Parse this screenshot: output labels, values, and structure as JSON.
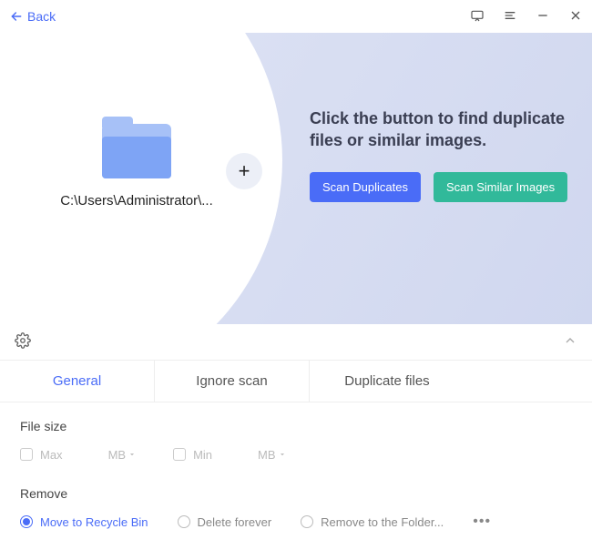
{
  "titlebar": {
    "back_label": "Back"
  },
  "hero": {
    "folder_path": "C:\\Users\\Administrator\\...",
    "prompt": "Click the button to find duplicate files or similar images.",
    "scan_duplicates_label": "Scan Duplicates",
    "scan_similar_label": "Scan Similar Images"
  },
  "tabs": {
    "general": "General",
    "ignore": "Ignore scan",
    "duplicate": "Duplicate files"
  },
  "settings": {
    "filesize_label": "File size",
    "max_label": "Max",
    "min_label": "Min",
    "unit": "MB",
    "remove_label": "Remove",
    "remove_options": {
      "recycle": "Move to Recycle Bin",
      "delete": "Delete forever",
      "folder": "Remove to the Folder..."
    }
  }
}
